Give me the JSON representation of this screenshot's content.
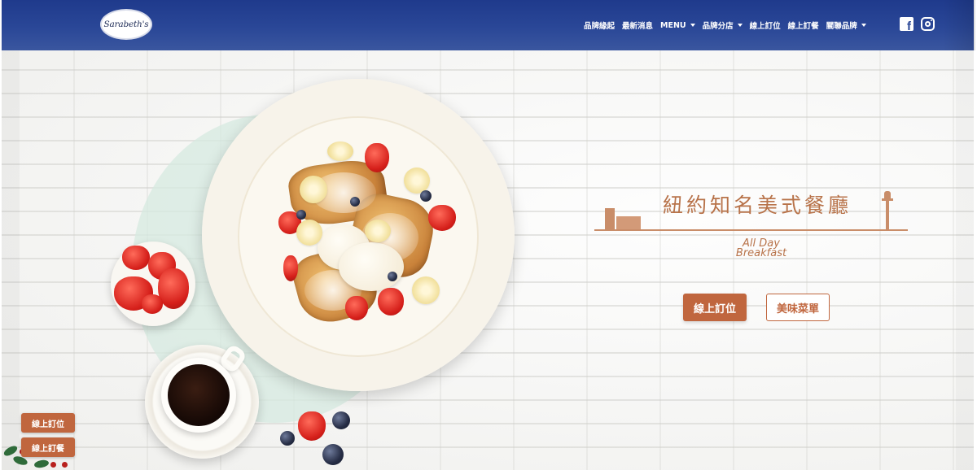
{
  "brand": {
    "logo_text": "Sarabeth's"
  },
  "header": {
    "nav": [
      {
        "label": "品牌緣起",
        "dropdown": false
      },
      {
        "label": "最新消息",
        "dropdown": false
      },
      {
        "label": "MENU",
        "dropdown": true
      },
      {
        "label": "品牌分店",
        "dropdown": true
      },
      {
        "label": "線上訂位",
        "dropdown": false
      },
      {
        "label": "線上訂餐",
        "dropdown": false
      },
      {
        "label": "關聯品牌",
        "dropdown": true
      }
    ],
    "social": [
      {
        "icon": "facebook-icon"
      },
      {
        "icon": "instagram-icon"
      }
    ]
  },
  "hero": {
    "tagline": "紐約知名美式餐廳",
    "subtitle_line1": "All Day",
    "subtitle_line2": "Breakfast",
    "primary_button": "線上訂位",
    "secondary_button": "美味菜單"
  },
  "floating": {
    "reserve": "線上訂位",
    "order": "線上訂餐"
  },
  "colors": {
    "header": "#2a4797",
    "accent": "#c0663e",
    "tagline": "#b8734a"
  }
}
